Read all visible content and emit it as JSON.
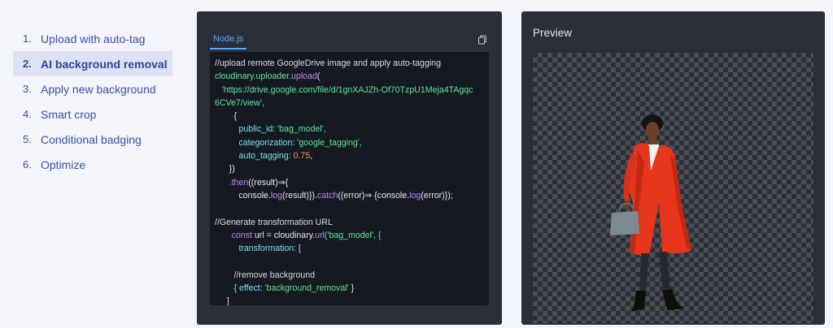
{
  "steps": [
    {
      "num": "1.",
      "label": "Upload with auto-tag"
    },
    {
      "num": "2.",
      "label": "AI background removal"
    },
    {
      "num": "3.",
      "label": "Apply new background"
    },
    {
      "num": "4.",
      "label": "Smart crop"
    },
    {
      "num": "5.",
      "label": "Conditional badging"
    },
    {
      "num": "6.",
      "label": "Optimize"
    }
  ],
  "code": {
    "tab_label": "Node.js",
    "copy_icon": "copy-icon",
    "lines": [
      "//upload remote GoogleDrive image and apply auto-tagging",
      "cloudinary.uploader.",
      "upload",
      "(",
      "'https://drive.google.com/file/d/1gnXAJZh-Of70TzpU1Meja4TAgqc",
      "6CVe7/view',",
      "{",
      "public_id: ",
      "'bag_model',",
      "categorization: ",
      "'google_tagging',",
      "auto_tagging: ",
      "0.75",
      ",",
      "})",
      ".then",
      "((result)⇒{",
      "console.",
      "log",
      "(result)}).",
      "catch",
      "((error)⇒ {console.",
      "log",
      "(error)});",
      "//Generate transformation URL",
      "const",
      " url = cloudinary.",
      "url",
      "('bag_model', {",
      "transformation: [",
      "//remove background",
      "{ effect: ",
      "'background_removal'",
      " }",
      "]",
      "});"
    ]
  },
  "preview": {
    "title": "Preview"
  }
}
